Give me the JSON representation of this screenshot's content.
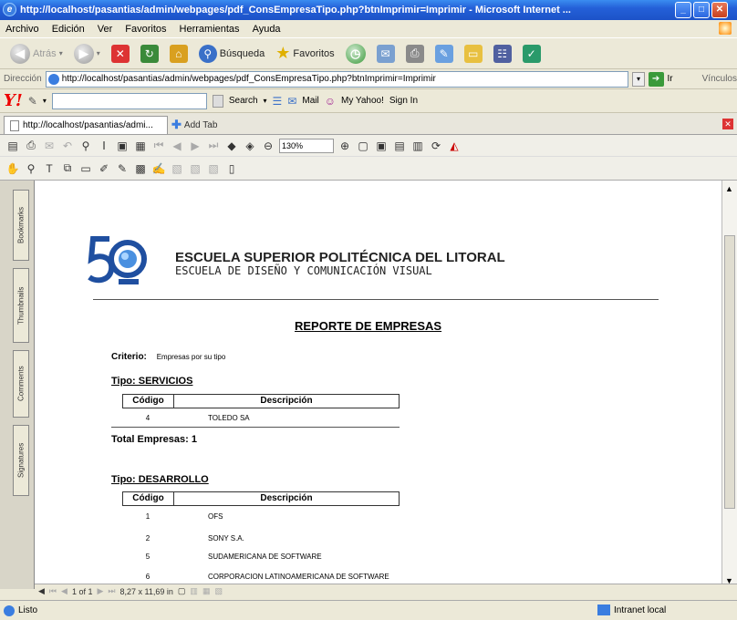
{
  "window": {
    "title": "http://localhost/pasantias/admin/webpages/pdf_ConsEmpresaTipo.php?btnImprimir=Imprimir - Microsoft Internet ..."
  },
  "menu": [
    "Archivo",
    "Edición",
    "Ver",
    "Favoritos",
    "Herramientas",
    "Ayuda"
  ],
  "toolbar": {
    "back_label": "Atrás",
    "search_label": "Búsqueda",
    "favorites_label": "Favoritos"
  },
  "address": {
    "label": "Dirección",
    "url": "http://localhost/pasantias/admin/webpages/pdf_ConsEmpresaTipo.php?btnImprimir=Imprimir",
    "go_label": "Ir",
    "links_label": "Vínculos"
  },
  "yahoo": {
    "search_label": "Search",
    "mail_label": "Mail",
    "myyahoo_label": "My Yahoo!",
    "signin_label": "Sign In"
  },
  "tabs": {
    "active_label": "http://localhost/pasantias/admi...",
    "add_label": "Add Tab"
  },
  "pdf": {
    "zoom": "130%",
    "page_indicator": "1 of 1",
    "page_size": "8,27 x 11,69 in"
  },
  "side_tabs": [
    "Bookmarks",
    "Thumbnails",
    "Comments",
    "Signatures"
  ],
  "document": {
    "school": "ESCUELA SUPERIOR POLITÉCNICA DEL LITORAL",
    "dept": "ESCUELA DE DISEÑO Y COMUNICACIÓN VISUAL",
    "report_title": "REPORTE DE EMPRESAS",
    "criterio_label": "Criterio:",
    "criterio_value": "Empresas por su tipo",
    "col_code": "Código",
    "col_desc": "Descripción",
    "groups": [
      {
        "tipo": "Tipo: SERVICIOS",
        "rows": [
          {
            "code": "4",
            "desc": "TOLEDO SA"
          }
        ],
        "total": "Total Empresas: 1"
      },
      {
        "tipo": "Tipo: DESARROLLO",
        "rows": [
          {
            "code": "1",
            "desc": "OFS"
          },
          {
            "code": "2",
            "desc": "SONY S.A."
          },
          {
            "code": "5",
            "desc": "SUDAMERICANA DE SOFTWARE"
          },
          {
            "code": "6",
            "desc": "CORPORACION LATINOAMERICANA DE SOFTWARE"
          }
        ]
      }
    ]
  },
  "status": {
    "left": "Listo",
    "zone": "Intranet local"
  }
}
